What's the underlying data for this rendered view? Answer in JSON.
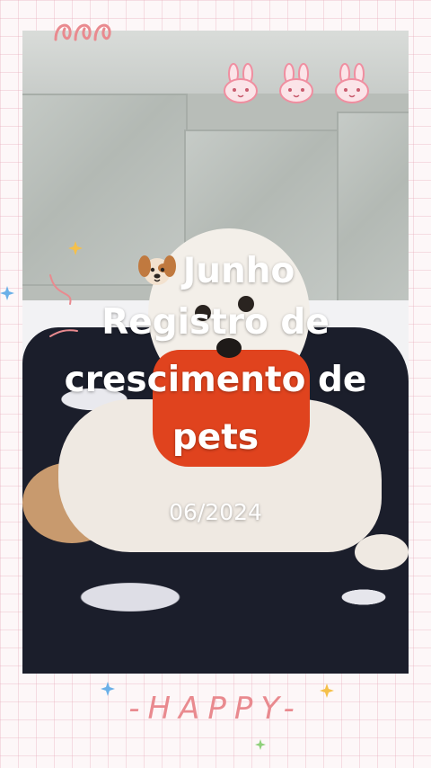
{
  "title": {
    "line1": "Junho",
    "line2": "Registro de",
    "line3": "crescimento de",
    "line4": "pets"
  },
  "date": "06/2024",
  "footer": {
    "happy": "-HAPPY-"
  },
  "icons": {
    "title_emoji": "dog-face-icon",
    "top_left": "swirl-doodle-icon",
    "top_right": "bunny-face-icon",
    "sparkles": "star-sparkle-icon"
  },
  "colors": {
    "background": "#fdf7f8",
    "grid_lines": "#e6aab9",
    "accent_pink": "#e98a8f",
    "text_white": "#ffffff"
  }
}
